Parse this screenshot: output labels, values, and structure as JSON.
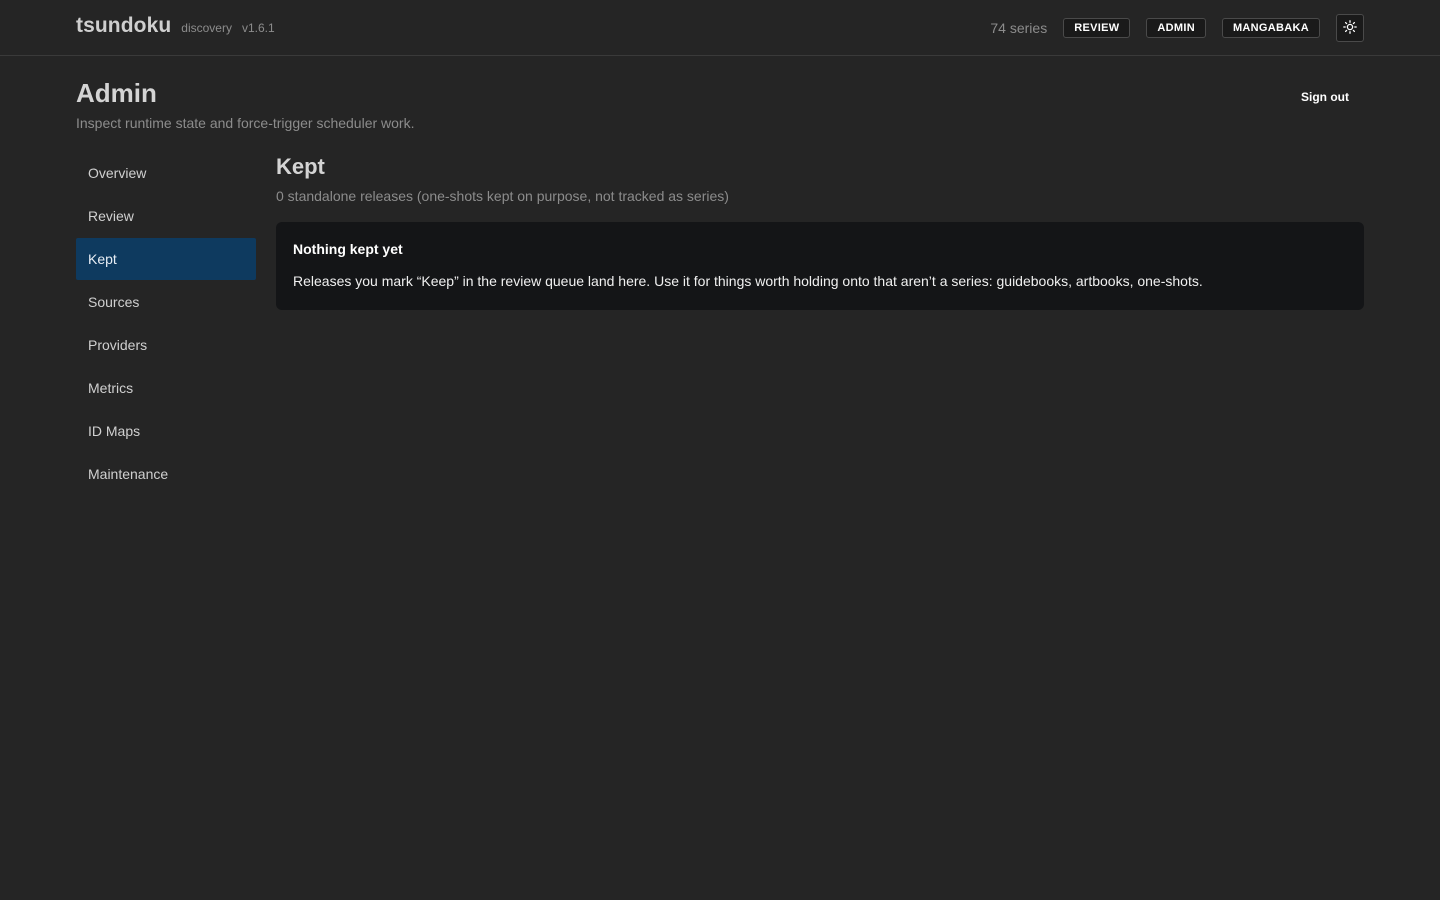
{
  "header": {
    "brand": "tsundoku",
    "tag": "discovery",
    "version": "v1.6.1",
    "series_count": "74 series",
    "nav": [
      {
        "label": "REVIEW"
      },
      {
        "label": "ADMIN"
      },
      {
        "label": "MANGABAKA"
      }
    ],
    "theme_icon": "sun-icon"
  },
  "page": {
    "title": "Admin",
    "subtitle": "Inspect runtime state and force-trigger scheduler work.",
    "signout_label": "Sign out"
  },
  "sidebar": {
    "active": "Kept",
    "items": [
      {
        "label": "Overview"
      },
      {
        "label": "Review"
      },
      {
        "label": "Kept"
      },
      {
        "label": "Sources"
      },
      {
        "label": "Providers"
      },
      {
        "label": "Metrics"
      },
      {
        "label": "ID Maps"
      },
      {
        "label": "Maintenance"
      }
    ]
  },
  "main": {
    "title": "Kept",
    "subtitle": "0 standalone releases (one-shots kept on purpose, not tracked as series)",
    "empty": {
      "title": "Nothing kept yet",
      "body": "Releases you mark “Keep” in the review queue land here. Use it for things worth holding onto that aren’t a series: guidebooks, artbooks, one-shots."
    }
  },
  "colors": {
    "background": "#252525",
    "active_nav": "#0e3a5f",
    "card": "#141517"
  }
}
